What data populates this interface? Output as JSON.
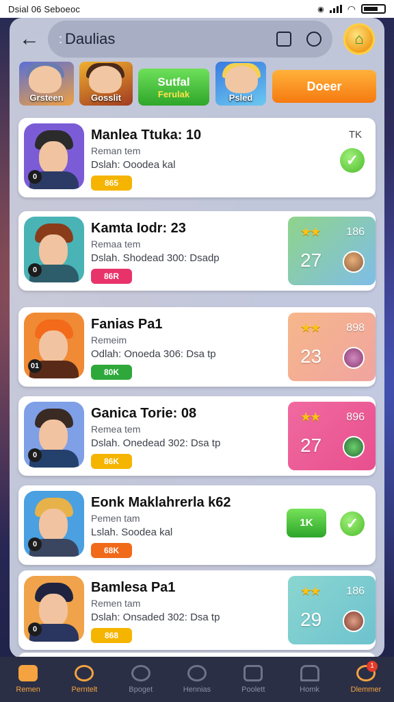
{
  "status": {
    "time": "Dsial 06 Seboeoc"
  },
  "header": {
    "search_text": "Daulias",
    "search_prefix": ":"
  },
  "chips": [
    {
      "label": "Grsteen",
      "type": "hero"
    },
    {
      "label": "Gosslit",
      "type": "hero"
    },
    {
      "label1": "Sutfal",
      "label2": "Ferulak",
      "type": "button-green"
    },
    {
      "label": "Psled",
      "type": "hero"
    },
    {
      "label": "Doeer",
      "type": "button-orange"
    }
  ],
  "cards": [
    {
      "title": "Manlea Ttuka: 10",
      "subtitle": "Reman tem",
      "desc": "Dslah: Ooodea kal",
      "tag": "865",
      "tag_color": "#f5b400",
      "level": "0",
      "top_right": "TK",
      "colors": {
        "bg": "#7b5cd6",
        "hair": "#2b2b2b",
        "body": "#2c3a66"
      }
    },
    {
      "title": "Kamta Iodr: 23",
      "subtitle": "Remaa tem",
      "desc": "Dslah. Shodead 300: Dsadp",
      "tag": "86R",
      "tag_color": "#e8336a",
      "level": "0",
      "stat_small": "186",
      "stat_big": "27",
      "stat_gradient": [
        "#8fd48a",
        "#7fbde8"
      ],
      "colors": {
        "bg": "#4ab3b6",
        "hair": "#8a3b1a",
        "body": "#2d5d6a"
      }
    },
    {
      "title": "Fanias Pa1",
      "subtitle": "Remeim",
      "desc": "Odlah: Onoeda 306: Dsa tp",
      "tag": "80K",
      "tag_color": "#2ea83a",
      "level": "01",
      "stat_small": "898",
      "stat_big": "23",
      "stat_gradient": [
        "#f7b78a",
        "#f0a4a0"
      ],
      "colors": {
        "bg": "#f08a34",
        "hair": "#f26a1a",
        "body": "#5a2a18"
      }
    },
    {
      "title": "Ganica Torie: 08",
      "subtitle": "Remea tem",
      "desc": "Dslah. Onedead 302: Dsa tp",
      "tag": "86K",
      "tag_color": "#f5b400",
      "level": "0",
      "stat_small": "896",
      "stat_big": "27",
      "stat_gradient": [
        "#f06aa0",
        "#e84f8e"
      ],
      "colors": {
        "bg": "#7fa0e6",
        "hair": "#3a2a24",
        "body": "#24406c"
      }
    },
    {
      "title": "Eonk Maklahrerla k62",
      "subtitle": "Pemen tam",
      "desc": "Lslah. Soodea kal",
      "tag": "68K",
      "tag_color": "#f06a1a",
      "level": "0",
      "green_chip": "1K",
      "colors": {
        "bg": "#4aa0e0",
        "hair": "#e8b24a",
        "body": "#3a4660"
      }
    },
    {
      "title": "Bamlesa Pa1",
      "subtitle": "Remen tam",
      "desc": "Dslah: Onsaded 302: Dsa tp",
      "tag": "868",
      "tag_color": "#f5b400",
      "level": "0",
      "stat_small": "186",
      "stat_big": "29",
      "stat_gradient": [
        "#8ad6d0",
        "#6ec2cf"
      ],
      "colors": {
        "bg": "#f0a34a",
        "hair": "#1f2340",
        "body": "#2a3560"
      }
    }
  ],
  "nav": [
    {
      "label": "Remen",
      "state": "active"
    },
    {
      "label": "Perntelt",
      "state": "gold"
    },
    {
      "label": "Bpoget",
      "state": "normal"
    },
    {
      "label": "Hennias",
      "state": "normal"
    },
    {
      "label": "Poolett",
      "state": "normal"
    },
    {
      "label": "Homk",
      "state": "normal"
    },
    {
      "label": "Dlemmer",
      "state": "gold",
      "badge": "1"
    }
  ]
}
